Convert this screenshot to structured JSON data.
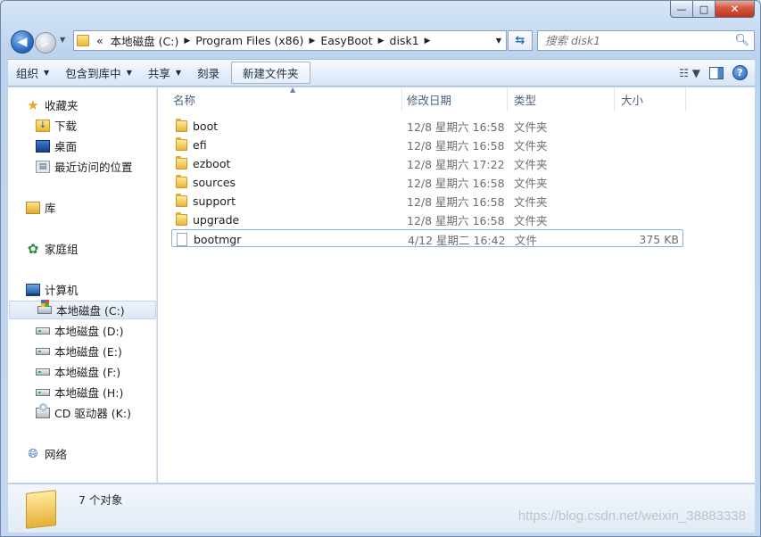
{
  "window": {
    "controls": {
      "minimize": "—",
      "maximize": "□",
      "close": "✕"
    }
  },
  "nav": {
    "back_icon": "back-arrow-icon",
    "forward_icon": "forward-arrow-icon",
    "breadcrumb": {
      "overflow": "«",
      "items": [
        "本地磁盘 (C:)",
        "Program Files (x86)",
        "EasyBoot",
        "disk1"
      ],
      "separator": "▶"
    },
    "search_placeholder": "搜索 disk1"
  },
  "toolbar": {
    "organize": "组织",
    "include_in_library": "包含到库中",
    "share": "共享",
    "burn": "刻录",
    "new_folder": "新建文件夹"
  },
  "sidebar": {
    "favorites": {
      "label": "收藏夹",
      "items": [
        "下载",
        "桌面",
        "最近访问的位置"
      ]
    },
    "libraries": {
      "label": "库"
    },
    "homegroup": {
      "label": "家庭组"
    },
    "computer": {
      "label": "计算机",
      "items": [
        "本地磁盘 (C:)",
        "本地磁盘 (D:)",
        "本地磁盘 (E:)",
        "本地磁盘 (F:)",
        "本地磁盘 (H:)",
        "CD 驱动器 (K:)"
      ],
      "selected": "本地磁盘 (C:)"
    },
    "network": {
      "label": "网络"
    }
  },
  "columns": [
    "名称",
    "修改日期",
    "类型",
    "大小"
  ],
  "files": [
    {
      "name": "boot",
      "date": "12/8 星期六 16:58",
      "type": "文件夹",
      "size": "",
      "kind": "folder"
    },
    {
      "name": "efi",
      "date": "12/8 星期六 16:58",
      "type": "文件夹",
      "size": "",
      "kind": "folder"
    },
    {
      "name": "ezboot",
      "date": "12/8 星期六 17:22",
      "type": "文件夹",
      "size": "",
      "kind": "folder"
    },
    {
      "name": "sources",
      "date": "12/8 星期六 16:58",
      "type": "文件夹",
      "size": "",
      "kind": "folder"
    },
    {
      "name": "support",
      "date": "12/8 星期六 16:58",
      "type": "文件夹",
      "size": "",
      "kind": "folder"
    },
    {
      "name": "upgrade",
      "date": "12/8 星期六 16:58",
      "type": "文件夹",
      "size": "",
      "kind": "folder"
    },
    {
      "name": "bootmgr",
      "date": "4/12 星期二 16:42",
      "type": "文件",
      "size": "375 KB",
      "kind": "file"
    }
  ],
  "status": {
    "item_count": "7 个对象"
  },
  "watermark": "https://blog.csdn.net/weixin_38883338"
}
